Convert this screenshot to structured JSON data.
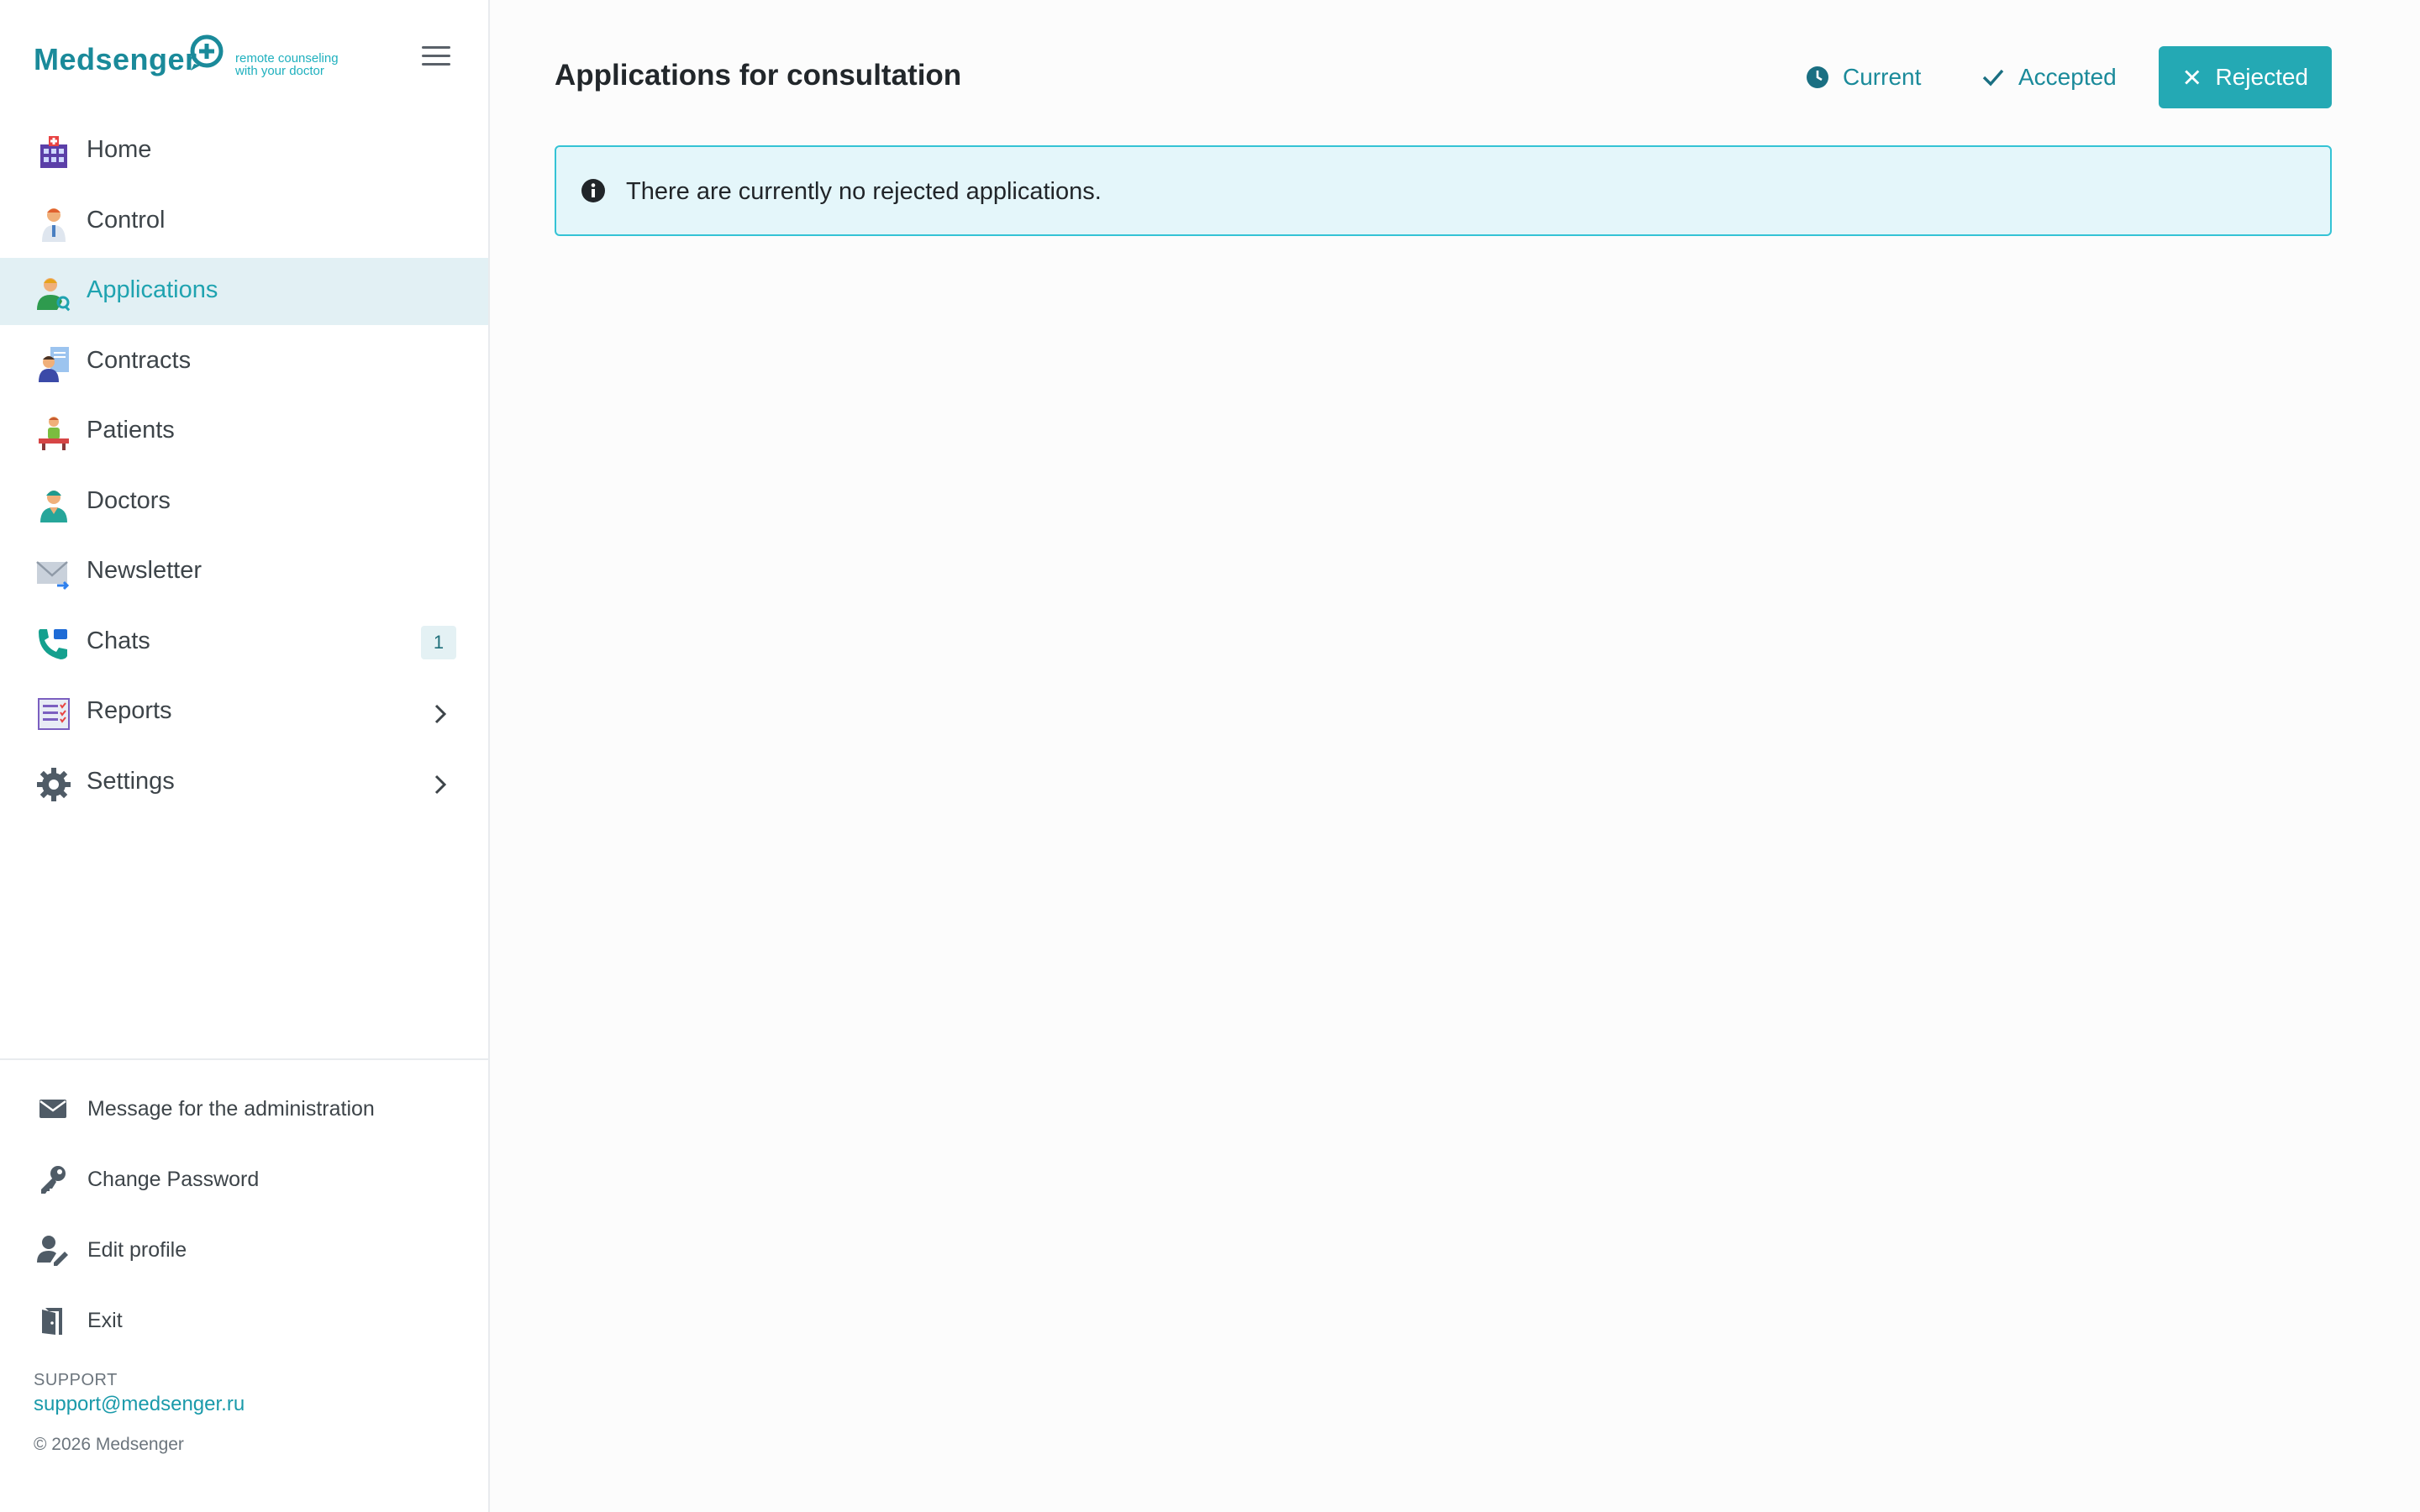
{
  "brand": {
    "name_prefix": "Med",
    "name_suffix": "senger",
    "tagline_line1": "remote counseling",
    "tagline_line2": "with your doctor",
    "accent_color": "#24a9b4"
  },
  "sidebar": {
    "items": [
      {
        "label": "Home",
        "icon": "hospital-icon"
      },
      {
        "label": "Control",
        "icon": "doctor-icon"
      },
      {
        "label": "Applications",
        "icon": "user-search-icon",
        "active": true
      },
      {
        "label": "Contracts",
        "icon": "contract-icon"
      },
      {
        "label": "Patients",
        "icon": "patient-icon"
      },
      {
        "label": "Doctors",
        "icon": "surgeon-icon"
      },
      {
        "label": "Newsletter",
        "icon": "envelope-icon"
      },
      {
        "label": "Chats",
        "icon": "phone-icon",
        "badge": "1"
      },
      {
        "label": "Reports",
        "icon": "report-icon",
        "expandable": true
      },
      {
        "label": "Settings",
        "icon": "gear-icon",
        "expandable": true
      }
    ],
    "bottom_items": [
      {
        "label": "Message for the administration",
        "icon": "mail-icon"
      },
      {
        "label": "Change Password",
        "icon": "key-icon"
      },
      {
        "label": "Edit profile",
        "icon": "user-edit-icon"
      },
      {
        "label": "Exit",
        "icon": "door-exit-icon"
      }
    ],
    "support_label": "SUPPORT",
    "support_email": "support@medsenger.ru",
    "copyright": "© 2026 Medsenger"
  },
  "main": {
    "title": "Applications for consultation",
    "tabs": [
      {
        "label": "Current",
        "icon": "clock-icon"
      },
      {
        "label": "Accepted",
        "icon": "check-icon"
      },
      {
        "label": "Rejected",
        "icon": "close-icon",
        "selected": true
      }
    ],
    "alert_text": "There are currently no rejected applications."
  }
}
